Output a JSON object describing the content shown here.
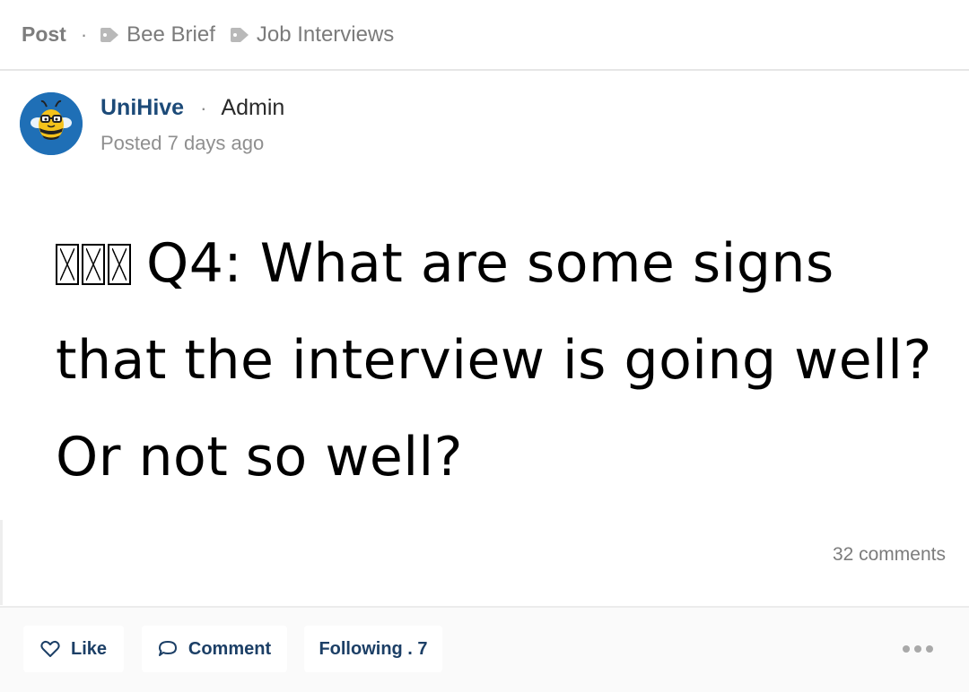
{
  "breadcrumb": {
    "post_label": "Post",
    "separator": "·",
    "tags": [
      {
        "label": "Bee Brief",
        "icon": "tag-icon"
      },
      {
        "label": "Job Interviews",
        "icon": "tag-icon"
      }
    ]
  },
  "author": {
    "name": "UniHive",
    "separator": "·",
    "role": "Admin",
    "posted": "Posted 7 days ago",
    "avatar_icon": "bee-mascot-icon"
  },
  "post": {
    "title_text": "Q4: What are some signs that the interview is going well? Or not so well?"
  },
  "stats": {
    "comments": "32 comments"
  },
  "actions": {
    "like_label": "Like",
    "comment_label": "Comment",
    "following_label": "Following . 7",
    "more_icon": "more-options-icon"
  },
  "colors": {
    "author_name": "#1c4a78",
    "action_text": "#1c3f66",
    "avatar_bg": "#1f6fb6",
    "muted_text": "#7b7b7b"
  }
}
